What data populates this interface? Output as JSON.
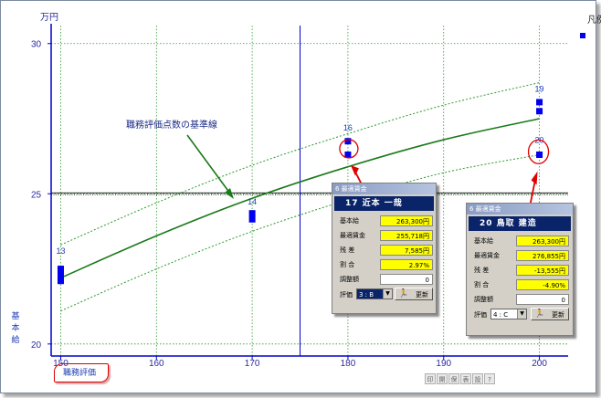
{
  "chart_data": {
    "type": "scatter",
    "y_unit": "万円",
    "y_ticks": [
      "30",
      "25",
      "20"
    ],
    "x_ticks": [
      "150",
      "160",
      "170",
      "180",
      "190",
      "200"
    ],
    "x_range": [
      149,
      203
    ],
    "y_range": [
      19.6,
      30.6
    ],
    "ylabel": "基本給",
    "xlabel": "職務評価",
    "legend": "凡例",
    "reference_line_y": 25,
    "cursor_line_x": 175,
    "baseline": {
      "x": [
        150,
        160,
        170,
        180,
        190,
        200
      ],
      "y": [
        22.2,
        23.6,
        24.85,
        25.9,
        26.8,
        27.5
      ]
    },
    "upper_band": {
      "x": [
        150,
        160,
        170,
        180,
        190,
        200
      ],
      "y": [
        23.3,
        24.7,
        25.95,
        27.0,
        27.95,
        28.7
      ]
    },
    "lower_band": {
      "x": [
        150,
        160,
        170,
        180,
        190,
        200
      ],
      "y": [
        21.1,
        22.5,
        23.75,
        24.8,
        25.7,
        26.3
      ]
    },
    "points": [
      {
        "label": "13",
        "x": 150,
        "y": 22.1
      },
      {
        "label": "13",
        "x": 150,
        "y": 22.3
      },
      {
        "label": "13",
        "x": 150,
        "y": 22.5
      },
      {
        "label": "14",
        "x": 170,
        "y": 24.15
      },
      {
        "label": "14",
        "x": 170,
        "y": 24.35
      },
      {
        "label": "16",
        "x": 180,
        "y": 26.3
      },
      {
        "label": "16",
        "x": 180,
        "y": 26.75
      },
      {
        "label": "19",
        "x": 200,
        "y": 27.75
      },
      {
        "label": "19",
        "x": 200,
        "y": 28.05
      },
      {
        "label": "20",
        "x": 200,
        "y": 26.3
      }
    ],
    "point_labels": [
      {
        "text": "13",
        "x": 150,
        "y": 23.0
      },
      {
        "text": "14",
        "x": 170,
        "y": 24.65
      },
      {
        "text": "16",
        "x": 180,
        "y": 27.1
      },
      {
        "text": "19",
        "x": 200,
        "y": 28.4
      },
      {
        "text": "20",
        "x": 200,
        "y": 26.7
      }
    ],
    "annotation": "職務評価点数の基準線"
  },
  "popup_left": {
    "title": "6 最適賃金",
    "header": "17 近本 一哉",
    "rows": [
      {
        "label": "基本給",
        "value": "263,300円"
      },
      {
        "label": "最適賃金",
        "value": "255,718円"
      },
      {
        "label": "残 差",
        "value": "7,585円"
      },
      {
        "label": "割 合",
        "value": "2.97%"
      },
      {
        "label": "調整額",
        "value": "0"
      }
    ],
    "grade_label": "評価",
    "grade_value": "3 : B",
    "update_label": "更新"
  },
  "popup_right": {
    "title": "6 最適賃金",
    "header": "20 鳥取 建造",
    "rows": [
      {
        "label": "基本給",
        "value": "263,300円"
      },
      {
        "label": "最適賃金",
        "value": "276,855円"
      },
      {
        "label": "残 差",
        "value": "-13,555円"
      },
      {
        "label": "割 合",
        "value": "-4.90%"
      },
      {
        "label": "調整額",
        "value": "0"
      }
    ],
    "grade_label": "評価",
    "grade_value": "4 : C",
    "update_label": "更新"
  },
  "toolbar": [
    "印",
    "開",
    "保",
    "表",
    "設",
    "?"
  ],
  "colors": {
    "axis": "#0000cc",
    "baseline": "#1a7a1a",
    "band": "#2a9a2a",
    "point": "#0000ee",
    "highlight": "#e00000"
  }
}
